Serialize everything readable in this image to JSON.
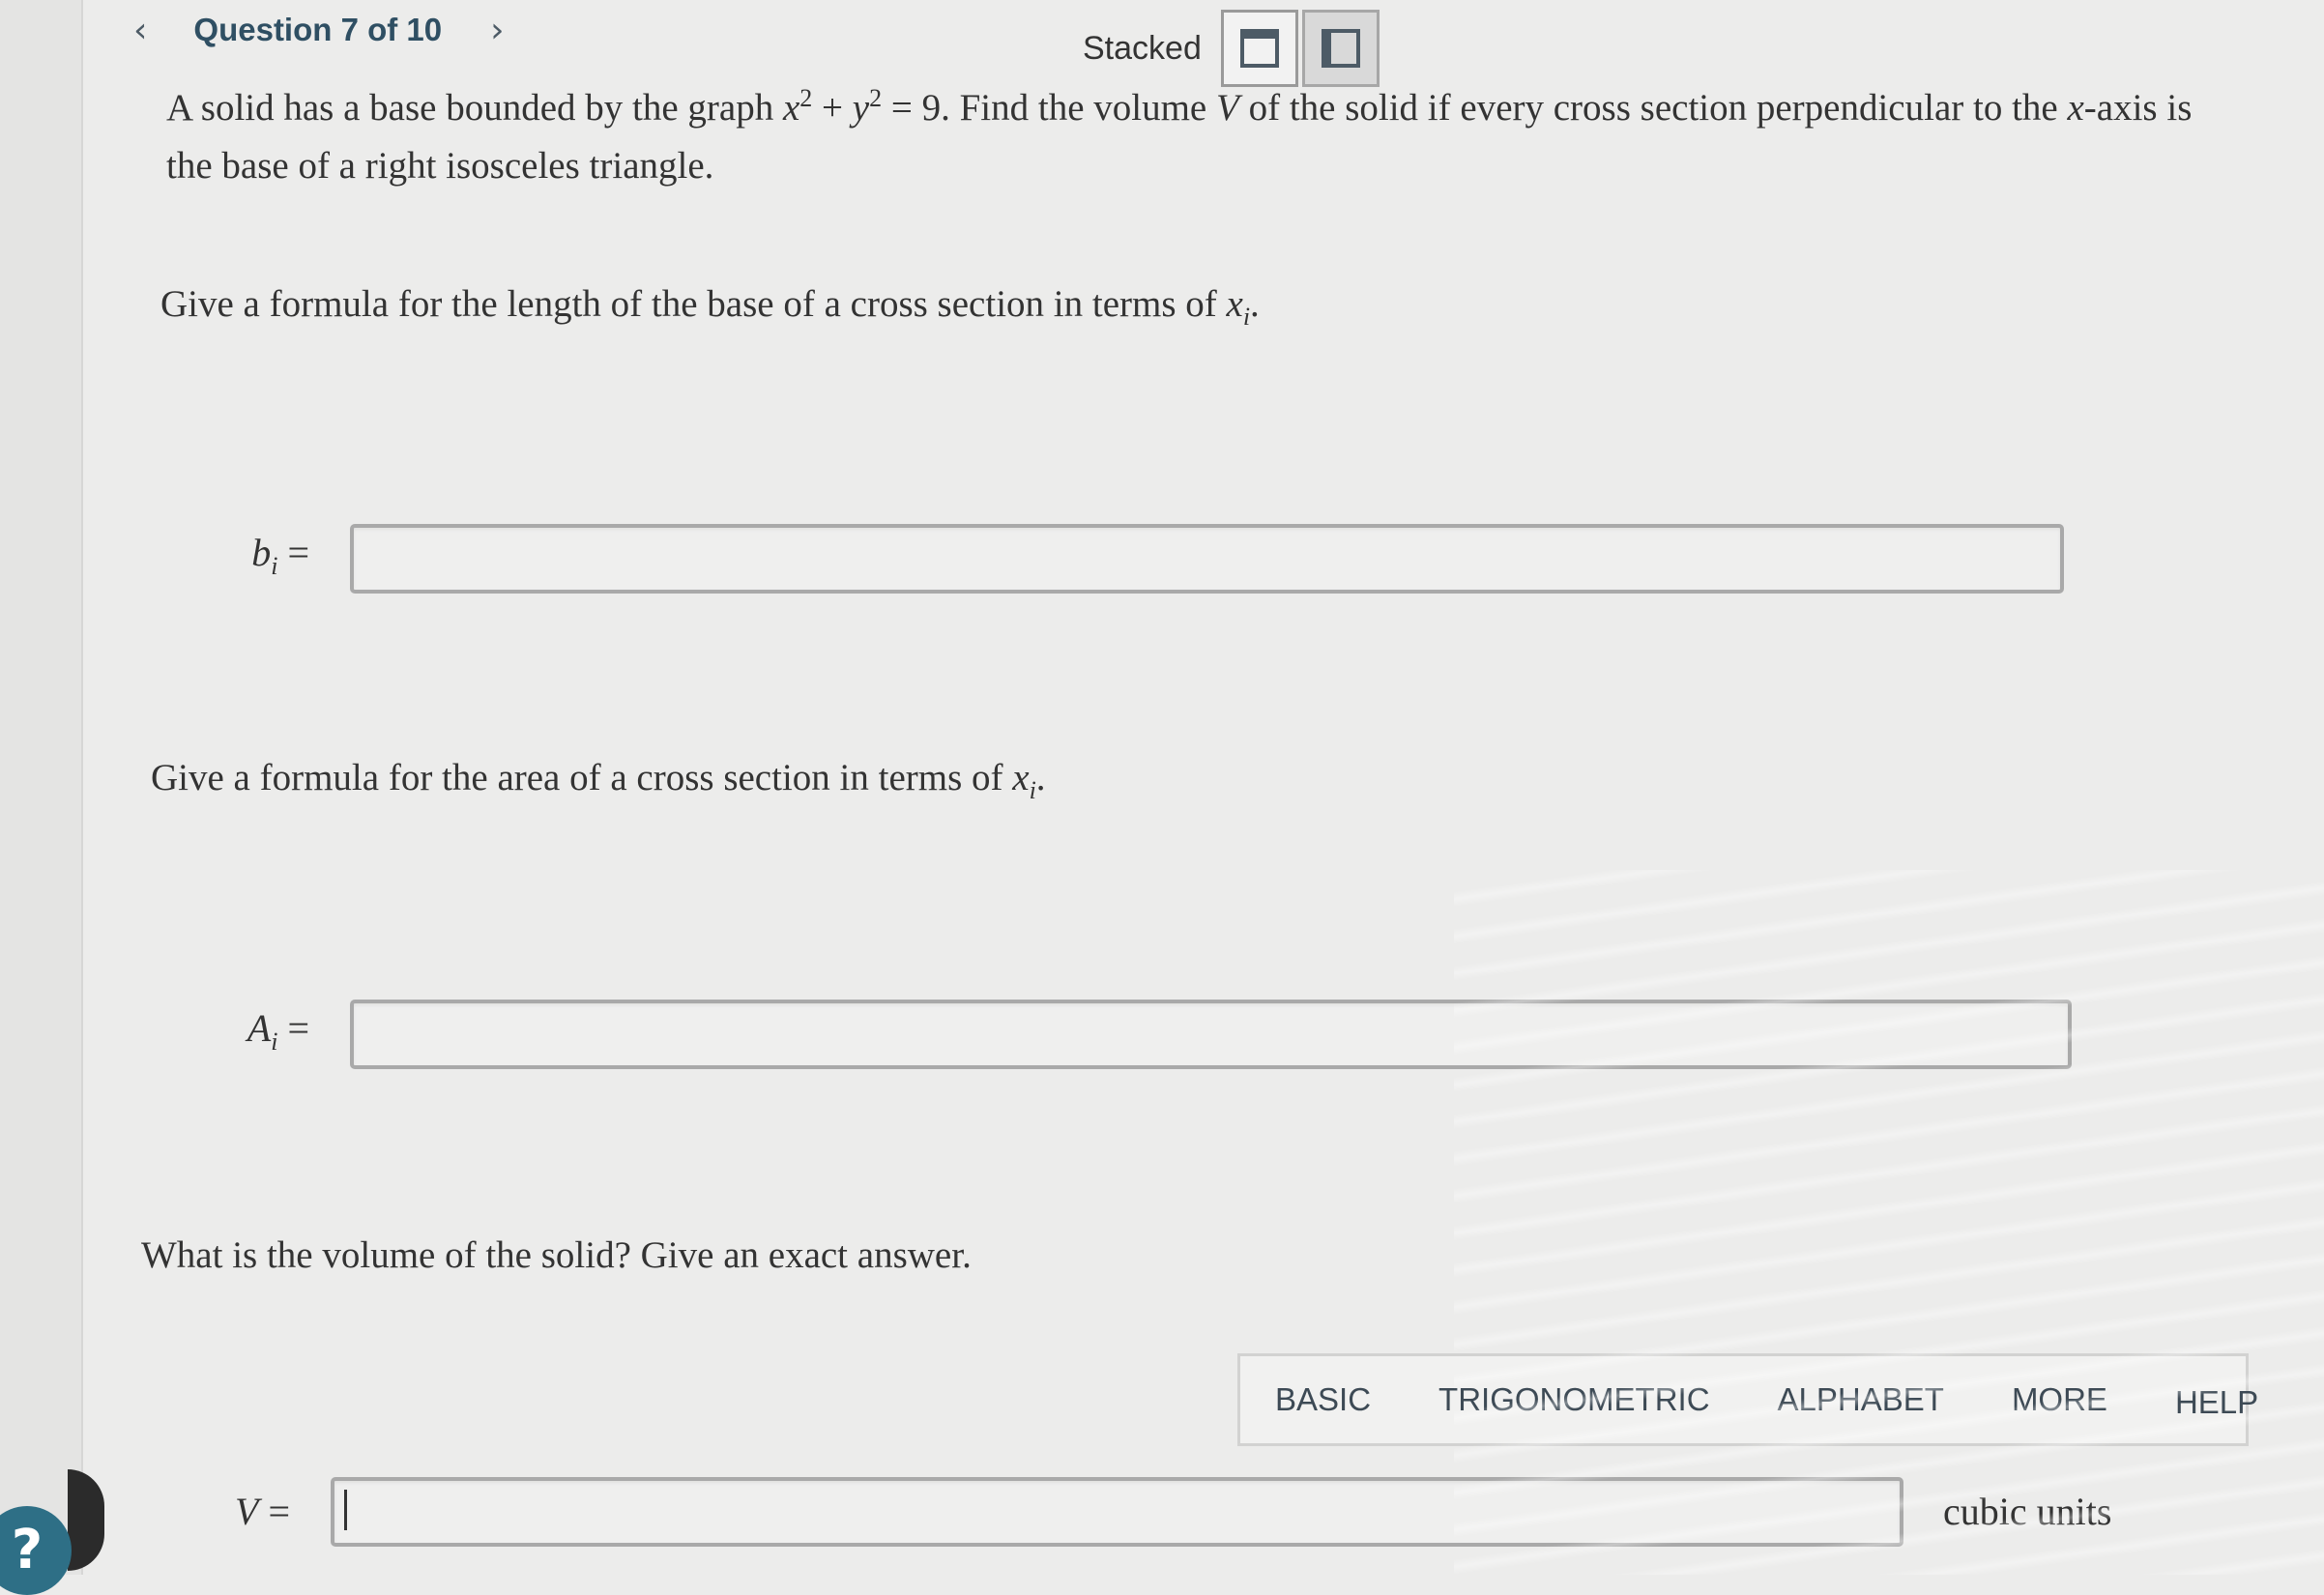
{
  "nav": {
    "prev_icon": "chevron-left-icon",
    "title": "Question 7 of 10",
    "next_icon": "chevron-right-icon"
  },
  "layout": {
    "label": "Stacked",
    "stacked_icon": "stacked-layout-icon",
    "side_icon": "side-by-side-layout-icon"
  },
  "question": {
    "intro": "A solid has a base bounded by the graph ",
    "eq_lhs_x": "x",
    "eq_plus": " + ",
    "eq_lhs_y": "y",
    "eq_exp": "2",
    "eq_rhs": " = 9. Find the volume ",
    "vol_var": "V",
    "mid": " of the solid if every cross section perpendicular to the ",
    "axis_var": "x",
    "end": "-axis is the base of a right isosceles triangle."
  },
  "part1": {
    "prompt": "Give a formula for the length of the base of a cross section in terms of ",
    "var": "x",
    "sub": "i",
    "period": ".",
    "label_var": "b",
    "label_sub": "i",
    "equals": " =",
    "value": ""
  },
  "part2": {
    "prompt": "Give a formula for the area of a cross section in terms of ",
    "var": "x",
    "sub": "i",
    "period": ".",
    "label_var": "A",
    "label_sub": "i",
    "equals": " =",
    "value": ""
  },
  "part3": {
    "prompt": "What is the volume of the solid? Give an exact answer.",
    "label_var": "V",
    "equals": " =",
    "value": "",
    "units": "cubic units"
  },
  "math_tabs": [
    "BASIC",
    "TRIGONOMETRIC",
    "ALPHABET",
    "MORE",
    "HELP"
  ],
  "help_button": "?",
  "colors": {
    "page_bg": "#ececeb",
    "nav_text": "#2f4f63",
    "help_circle": "#2e6f86"
  }
}
